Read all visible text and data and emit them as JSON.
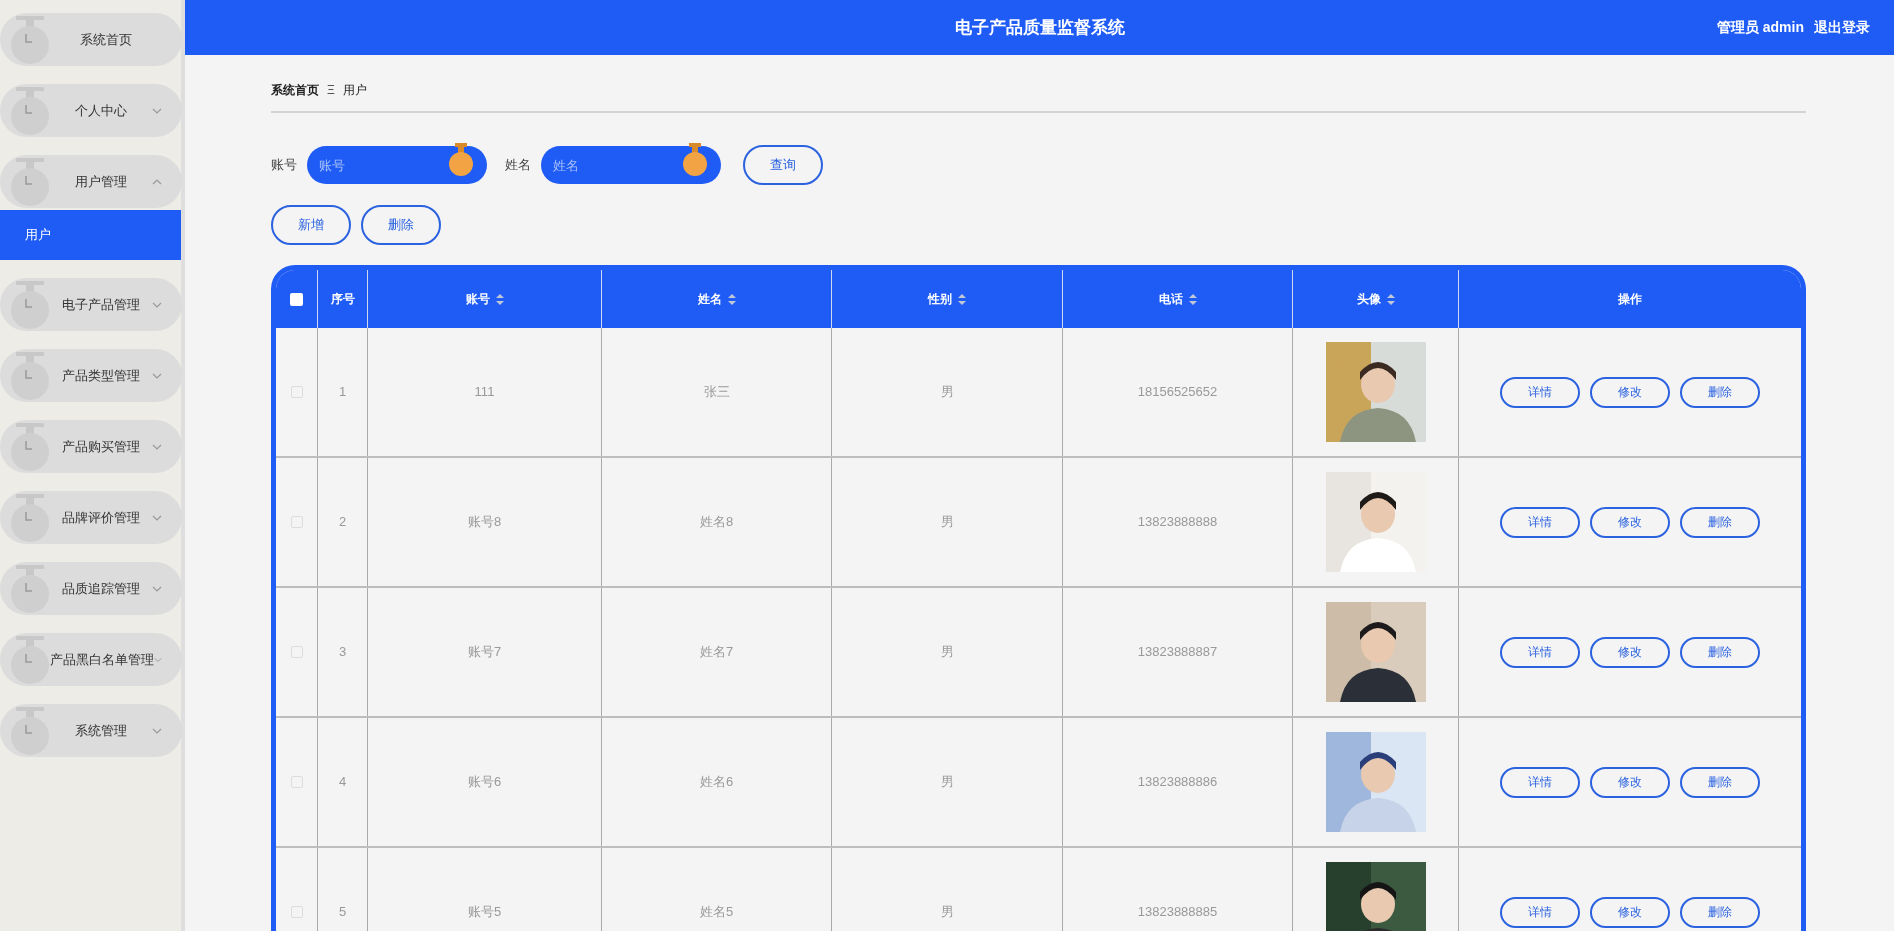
{
  "header": {
    "title": "电子产品质量监督系统",
    "user": "管理员 admin",
    "logout": "退出登录"
  },
  "sidebar": {
    "items": [
      {
        "label": "系统首页"
      },
      {
        "label": "个人中心",
        "expanded": false
      },
      {
        "label": "用户管理",
        "expanded": true,
        "children": [
          {
            "label": "用户",
            "selected": true
          }
        ]
      },
      {
        "label": "电子产品管理",
        "expanded": false
      },
      {
        "label": "产品类型管理",
        "expanded": false
      },
      {
        "label": "产品购买管理",
        "expanded": false
      },
      {
        "label": "品牌评价管理",
        "expanded": false
      },
      {
        "label": "品质追踪管理",
        "expanded": false
      },
      {
        "label": "产品黑白名单管理",
        "expanded": false
      },
      {
        "label": "系统管理",
        "expanded": false
      }
    ]
  },
  "breadcrumb": {
    "items": [
      "系统首页",
      "用户"
    ],
    "separator": "Ξ"
  },
  "search": {
    "fields": [
      {
        "label": "账号",
        "placeholder": "账号"
      },
      {
        "label": "姓名",
        "placeholder": "姓名"
      }
    ],
    "button": "查询"
  },
  "actions": [
    "新增",
    "删除"
  ],
  "table": {
    "select_all_checked": false,
    "columns": [
      {
        "label": "序号",
        "sortable": false
      },
      {
        "label": "账号",
        "sortable": true
      },
      {
        "label": "姓名",
        "sortable": true
      },
      {
        "label": "性别",
        "sortable": true
      },
      {
        "label": "电话",
        "sortable": true
      },
      {
        "label": "头像",
        "sortable": true
      },
      {
        "label": "操作",
        "sortable": false
      }
    ],
    "rows": [
      {
        "checked": false,
        "index": "1",
        "account": "111",
        "name": "张三",
        "gender": "男",
        "phone": "18156525652",
        "buttons": [
          "详情",
          "修改",
          "删除"
        ]
      },
      {
        "checked": false,
        "index": "2",
        "account": "账号8",
        "name": "姓名8",
        "gender": "男",
        "phone": "13823888888",
        "buttons": [
          "详情",
          "修改",
          "删除"
        ]
      },
      {
        "checked": false,
        "index": "3",
        "account": "账号7",
        "name": "姓名7",
        "gender": "男",
        "phone": "13823888887",
        "buttons": [
          "详情",
          "修改",
          "删除"
        ]
      },
      {
        "checked": false,
        "index": "4",
        "account": "账号6",
        "name": "姓名6",
        "gender": "男",
        "phone": "13823888886",
        "buttons": [
          "详情",
          "修改",
          "删除"
        ]
      },
      {
        "checked": false,
        "index": "5",
        "account": "账号5",
        "name": "姓名5",
        "gender": "男",
        "phone": "13823888885",
        "buttons": [
          "详情",
          "修改",
          "删除"
        ]
      }
    ]
  }
}
